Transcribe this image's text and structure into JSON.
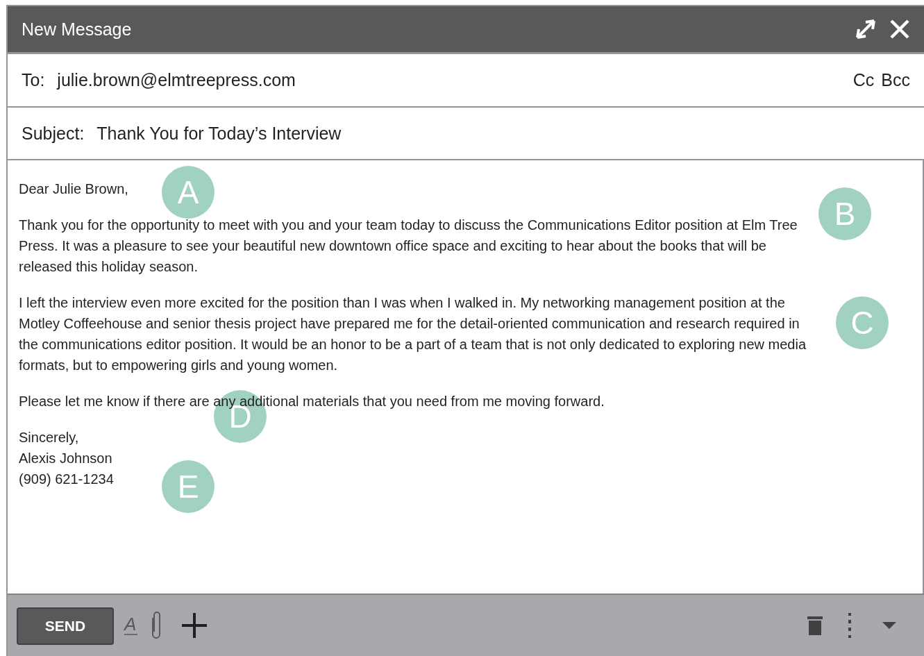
{
  "window": {
    "title": "New Message"
  },
  "to": {
    "label": "To:",
    "value": "julie.brown@elmtreepress.com",
    "links": [
      "Cc",
      "Bcc"
    ]
  },
  "subject": {
    "label": "Subject:",
    "value": "Thank You for Today’s Interview"
  },
  "body": {
    "paragraphs": [
      {
        "text": "Dear Julie Brown,"
      },
      {
        "text": "Thank you for the opportunity to meet with you and your team today to discuss the Communications Editor position at Elm Tree Press. It was a pleasure to see your beautiful new downtown office space and exciting to hear about the books that will be released this holiday season."
      },
      {
        "text": "I left the interview even more excited for the position than I was when I walked in. My networking management position at the Motley Coffeehouse and senior thesis project have prepared me for the detail-oriented communication and research required in the communications editor position. It would be an honor to be a part of a team that is not only dedicated to exploring new media formats, but to empowering girls and young women."
      },
      {
        "text": "Please let me know if there are any additional materials that you need from me moving forward."
      },
      {
        "text": "Sincerely,\nAlexis Johnson\n(909) 621-1234"
      }
    ]
  },
  "markers": [
    {
      "label": "A"
    },
    {
      "label": "B"
    },
    {
      "label": "C"
    },
    {
      "label": "D"
    },
    {
      "label": "E"
    }
  ],
  "toolbar": {
    "send": "SEND",
    "format": "A"
  }
}
